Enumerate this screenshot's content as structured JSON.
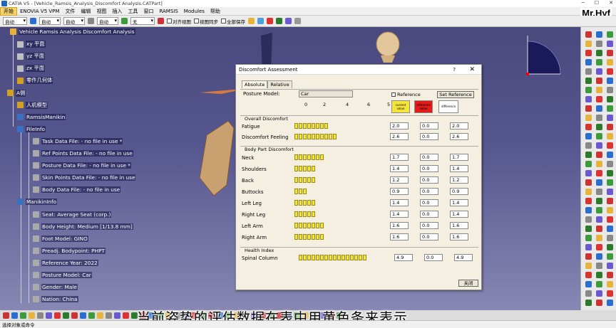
{
  "window": {
    "title": "CATIA V5 - [Vehicle_Ramsis_Analysis_Discomfort Analysis.CATPart]",
    "brand": "Mr.Hyf"
  },
  "menu": [
    "开始",
    "ENOVIA V5 VPM",
    "文件",
    "编辑",
    "视图",
    "插入",
    "工具",
    "窗口",
    "RAMSIS",
    "Modules",
    "帮助"
  ],
  "toolbar": {
    "combos": [
      "自动",
      "自动",
      "自动",
      "自动",
      "无"
    ],
    "check1": "对齐视图",
    "check2": "视图同步",
    "check3": "全部保存"
  },
  "tree": {
    "root": "Vehicle Ramsis Analysis Discomfort Analysis",
    "items": [
      "xy 平面",
      "yz 平面",
      "zx 平面",
      "零件几何体",
      "A侧",
      "人机模型",
      "RamsisManikin",
      "FileInfo",
      "Task Data File:  - no file in use *",
      "Ref Points Data File:  - no file in use",
      "Posture Data File:  - no file in use *",
      "Skin Points Data File:  - no file in use",
      "Body Data File:  - no file in use",
      "ManikinInfo",
      "Seat: Average Seat (corp.)",
      "Body Height: Medium [1/13.8 mm]",
      "Foot Model: GINO",
      "Preadj. Bodypoint: PHPT",
      "Reference Year: 2022",
      "Posture Model: Car",
      "Gender: Male",
      "Nation: China"
    ]
  },
  "dialog": {
    "title": "Discomfort Assessment",
    "help": "?",
    "close": "✕",
    "tabs": [
      "Absolute",
      "Relative"
    ],
    "posture_label": "Posture Model:",
    "posture_value": "Car",
    "reference_label": "Reference",
    "set_reference": "Set Reference",
    "scale": [
      "0",
      "2",
      "4",
      "6",
      "5"
    ],
    "legend": [
      "current value",
      "reference value",
      "difference"
    ],
    "overall_header": "Overall Discomfort",
    "overall": [
      {
        "name": "Fatigue",
        "bars": 8,
        "v": [
          "2.0",
          "0.0",
          "2.0"
        ]
      },
      {
        "name": "Discomfort Feeling",
        "bars": 10,
        "v": [
          "2.6",
          "0.0",
          "2.6"
        ]
      }
    ],
    "body_header": "Body Part Discomfort",
    "body": [
      {
        "name": "Neck",
        "bars": 7,
        "v": [
          "1.7",
          "0.0",
          "1.7"
        ]
      },
      {
        "name": "Shoulders",
        "bars": 5,
        "v": [
          "1.4",
          "0.0",
          "1.4"
        ]
      },
      {
        "name": "Back",
        "bars": 5,
        "v": [
          "1.2",
          "0.0",
          "1.2"
        ]
      },
      {
        "name": "Buttocks",
        "bars": 3,
        "v": [
          "0.9",
          "0.0",
          "0.9"
        ]
      },
      {
        "name": "Left Leg",
        "bars": 5,
        "v": [
          "1.4",
          "0.0",
          "1.4"
        ]
      },
      {
        "name": "Right Leg",
        "bars": 5,
        "v": [
          "1.4",
          "0.0",
          "1.4"
        ]
      },
      {
        "name": "Left Arm",
        "bars": 7,
        "v": [
          "1.6",
          "0.0",
          "1.6"
        ]
      },
      {
        "name": "Right Arm",
        "bars": 7,
        "v": [
          "1.6",
          "0.0",
          "1.6"
        ]
      }
    ],
    "health_header": "Health Index",
    "health": [
      {
        "name": "Spinal Column",
        "bars": 16,
        "v": [
          "4.9",
          "0.0",
          "4.9"
        ]
      }
    ],
    "close_button": "关闭"
  },
  "subtitle": "当前姿势的评估数据在表中用黄色条来表示",
  "status": "选择对象或命令",
  "colors": {
    "bar": "#f4e53c",
    "reference": "#e21b1b",
    "background": "#575790"
  }
}
